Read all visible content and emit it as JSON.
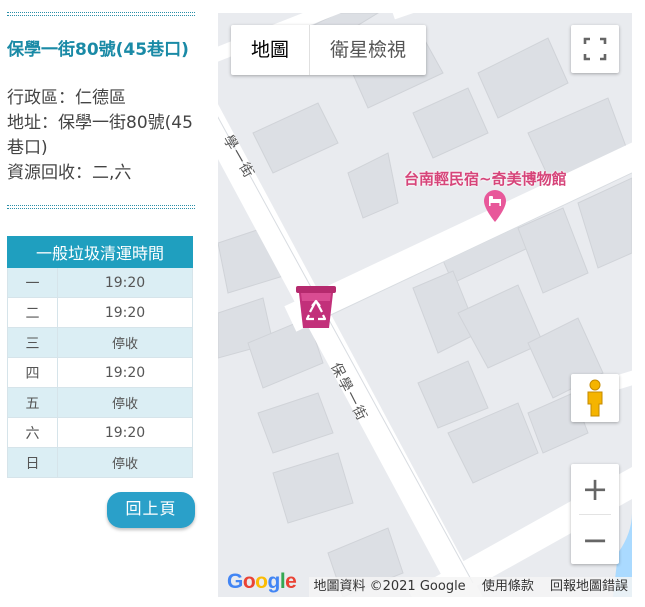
{
  "site": {
    "title": "保學一街80號(45巷口)",
    "district_label": "行政區：仁德區",
    "address_label": "地址：保學一街80號(45巷口)",
    "recycle_label": "資源回收：二,六"
  },
  "schedule": {
    "header": "一般垃圾清運時間",
    "rows": [
      {
        "day": "一",
        "time": "19:20"
      },
      {
        "day": "二",
        "time": "19:20"
      },
      {
        "day": "三",
        "time": "停收"
      },
      {
        "day": "四",
        "time": "19:20"
      },
      {
        "day": "五",
        "time": "停收"
      },
      {
        "day": "六",
        "time": "19:20"
      },
      {
        "day": "日",
        "time": "停收"
      }
    ]
  },
  "back_button": "回上頁",
  "map": {
    "type_options": [
      "地圖",
      "衛星檢視"
    ],
    "selected_type": "地圖",
    "poi_label": "台南輕民宿~奇美博物館",
    "street_name": "保學一街",
    "street_name_partial": "學一街",
    "marker_icon": "trash-can-recycle-icon",
    "zoom_in": "+",
    "zoom_out": "−",
    "google_logo": "Google",
    "attribution": "地圖資料 ©2021 Google",
    "terms": "使用條款",
    "report": "回報地圖錯誤",
    "colors": {
      "poi": "#d6457a",
      "marker": "#c2307a",
      "road": "#ffffff",
      "block": "#e9ebef",
      "building": "#dcdfe4"
    }
  },
  "colors": {
    "accent": "#1f9fbf",
    "title": "#1a8aa6",
    "row_alt": "#dbeef4",
    "button": "#2aa0c9"
  }
}
